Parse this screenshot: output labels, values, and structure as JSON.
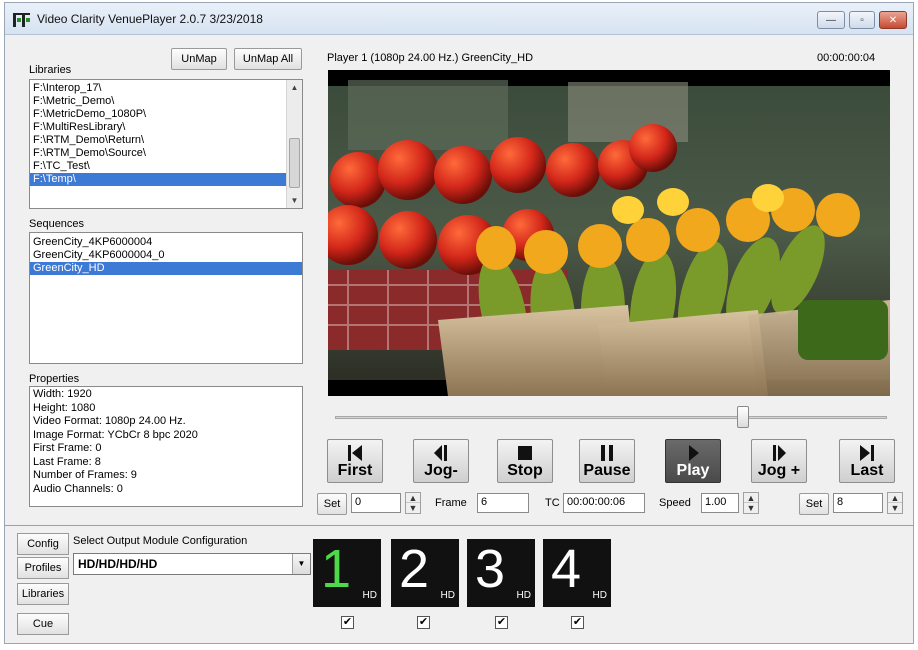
{
  "window": {
    "title": "Video Clarity VenuePlayer 2.0.7  3/23/2018",
    "controls": {
      "minimize": "—",
      "maximize": "▫",
      "close": "✕"
    }
  },
  "libraries": {
    "label": "Libraries",
    "unmap_label": "UnMap",
    "unmap_all_label": "UnMap All",
    "items": [
      "F:\\Interop_17\\",
      "F:\\Metric_Demo\\",
      "F:\\MetricDemo_1080P\\",
      "F:\\MultiResLibrary\\",
      "F:\\RTM_Demo\\Return\\",
      "F:\\RTM_Demo\\Source\\",
      "F:\\TC_Test\\",
      "F:\\Temp\\"
    ],
    "selected_index": 7
  },
  "sequences": {
    "label": "Sequences",
    "items": [
      "GreenCity_4KP6000004",
      "GreenCity_4KP6000004_0",
      "GreenCity_HD"
    ],
    "selected_index": 2
  },
  "properties": {
    "label": "Properties",
    "lines": [
      "Width: 1920",
      "Height: 1080",
      "Video Format: 1080p 24.00 Hz.",
      "Image Format: YCbCr 8 bpc 2020",
      "First Frame: 0",
      "Last Frame: 8",
      "Number of Frames: 9",
      "Audio Channels: 0"
    ]
  },
  "player": {
    "header": "Player 1  (1080p 24.00 Hz.)  GreenCity_HD",
    "timecode": "00:00:00:04",
    "scrub_position": 0.74
  },
  "transport": {
    "first": "First",
    "jog_back": "Jog-",
    "stop": "Stop",
    "pause": "Pause",
    "play": "Play",
    "jog_fwd": "Jog +",
    "last": "Last"
  },
  "fields": {
    "set_label": "Set",
    "set_start_value": "0",
    "frame_label": "Frame",
    "frame_value": "6",
    "tc_label": "TC",
    "tc_value": "00:00:00:06",
    "speed_label": "Speed",
    "speed_value": "1.00",
    "set_end_label": "Set",
    "set_end_value": "8"
  },
  "bottom": {
    "config": "Config",
    "profiles": "Profiles",
    "libraries": "Libraries",
    "cue": "Cue",
    "select_label": "Select Output Module Configuration",
    "select_value": "HD/HD/HD/HD",
    "modules": [
      {
        "num": "1",
        "sub": "HD",
        "checked": "✔"
      },
      {
        "num": "2",
        "sub": "HD",
        "checked": "✔"
      },
      {
        "num": "3",
        "sub": "HD",
        "checked": "✔"
      },
      {
        "num": "4",
        "sub": "HD",
        "checked": "✔"
      }
    ]
  }
}
